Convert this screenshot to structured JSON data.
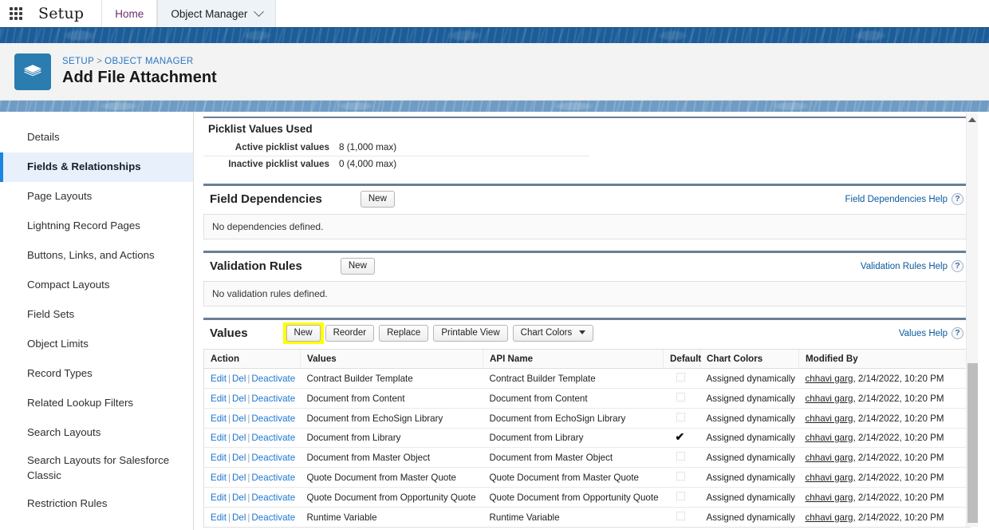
{
  "global_header": {
    "app_launcher_icon": "waffle-grid-icon",
    "setup_label": "Setup",
    "tabs": [
      {
        "label": "Home",
        "active": false,
        "has_chevron": false
      },
      {
        "label": "Object Manager",
        "active": true,
        "has_chevron": true
      }
    ]
  },
  "page_header": {
    "object_icon": "layers-stack-icon",
    "breadcrumb": {
      "setup": "SETUP",
      "separator": ">",
      "object_manager": "OBJECT MANAGER"
    },
    "title": "Add File Attachment"
  },
  "sidebar": {
    "items": [
      {
        "label": "Details",
        "active": false
      },
      {
        "label": "Fields & Relationships",
        "active": true
      },
      {
        "label": "Page Layouts",
        "active": false
      },
      {
        "label": "Lightning Record Pages",
        "active": false
      },
      {
        "label": "Buttons, Links, and Actions",
        "active": false
      },
      {
        "label": "Compact Layouts",
        "active": false
      },
      {
        "label": "Field Sets",
        "active": false
      },
      {
        "label": "Object Limits",
        "active": false
      },
      {
        "label": "Record Types",
        "active": false
      },
      {
        "label": "Related Lookup Filters",
        "active": false
      },
      {
        "label": "Search Layouts",
        "active": false
      },
      {
        "label": "Search Layouts for Salesforce Classic",
        "active": false
      },
      {
        "label": "Restriction Rules",
        "active": false
      }
    ]
  },
  "picklist_values_used": {
    "title": "Picklist Values Used",
    "rows": [
      {
        "label": "Active picklist values",
        "value": "8 (1,000 max)"
      },
      {
        "label": "Inactive picklist values",
        "value": "0 (4,000 max)"
      }
    ]
  },
  "field_dependencies": {
    "title": "Field Dependencies",
    "new_button": "New",
    "help_link": "Field Dependencies Help",
    "help_icon": "question-mark-icon",
    "empty_message": "No dependencies defined."
  },
  "validation_rules": {
    "title": "Validation Rules",
    "new_button": "New",
    "help_link": "Validation Rules Help",
    "help_icon": "question-mark-icon",
    "empty_message": "No validation rules defined."
  },
  "values_section": {
    "title": "Values",
    "help_link": "Values Help",
    "help_icon": "question-mark-icon",
    "highlight_color": "#ffff00",
    "buttons": [
      {
        "label": "New",
        "highlighted": true,
        "dropdown": false
      },
      {
        "label": "Reorder",
        "highlighted": false,
        "dropdown": false
      },
      {
        "label": "Replace",
        "highlighted": false,
        "dropdown": false
      },
      {
        "label": "Printable View",
        "highlighted": false,
        "dropdown": false
      },
      {
        "label": "Chart Colors",
        "highlighted": false,
        "dropdown": true
      }
    ],
    "table": {
      "columns": [
        "Action",
        "Values",
        "API Name",
        "Default",
        "Chart Colors",
        "Modified By"
      ],
      "action_links": [
        "Edit",
        "Del",
        "Deactivate"
      ],
      "action_separator": "|",
      "rows": [
        {
          "value": "Contract Builder Template",
          "api_name": "Contract Builder Template",
          "default": false,
          "chart_colors": "Assigned dynamically",
          "modified_by_user": "chhavi garg",
          "modified_by_date": ", 2/14/2022, 10:20 PM"
        },
        {
          "value": "Document from Content",
          "api_name": "Document from Content",
          "default": false,
          "chart_colors": "Assigned dynamically",
          "modified_by_user": "chhavi garg",
          "modified_by_date": ", 2/14/2022, 10:20 PM"
        },
        {
          "value": "Document from EchoSign Library",
          "api_name": "Document from EchoSign Library",
          "default": false,
          "chart_colors": "Assigned dynamically",
          "modified_by_user": "chhavi garg",
          "modified_by_date": ", 2/14/2022, 10:20 PM"
        },
        {
          "value": "Document from Library",
          "api_name": "Document from Library",
          "default": true,
          "chart_colors": "Assigned dynamically",
          "modified_by_user": "chhavi garg",
          "modified_by_date": ", 2/14/2022, 10:20 PM"
        },
        {
          "value": "Document from Master Object",
          "api_name": "Document from Master Object",
          "default": false,
          "chart_colors": "Assigned dynamically",
          "modified_by_user": "chhavi garg",
          "modified_by_date": ", 2/14/2022, 10:20 PM"
        },
        {
          "value": "Quote Document from Master Quote",
          "api_name": "Quote Document from Master Quote",
          "default": false,
          "chart_colors": "Assigned dynamically",
          "modified_by_user": "chhavi garg",
          "modified_by_date": ", 2/14/2022, 10:20 PM"
        },
        {
          "value": "Quote Document from Opportunity Quote",
          "api_name": "Quote Document from Opportunity Quote",
          "default": false,
          "chart_colors": "Assigned dynamically",
          "modified_by_user": "chhavi garg",
          "modified_by_date": ", 2/14/2022, 10:20 PM"
        },
        {
          "value": "Runtime Variable",
          "api_name": "Runtime Variable",
          "default": false,
          "chart_colors": "Assigned dynamically",
          "modified_by_user": "chhavi garg",
          "modified_by_date": ", 2/14/2022, 10:20 PM"
        }
      ]
    }
  },
  "scrollbar": {
    "up_arrow_icon": "caret-up-icon"
  }
}
